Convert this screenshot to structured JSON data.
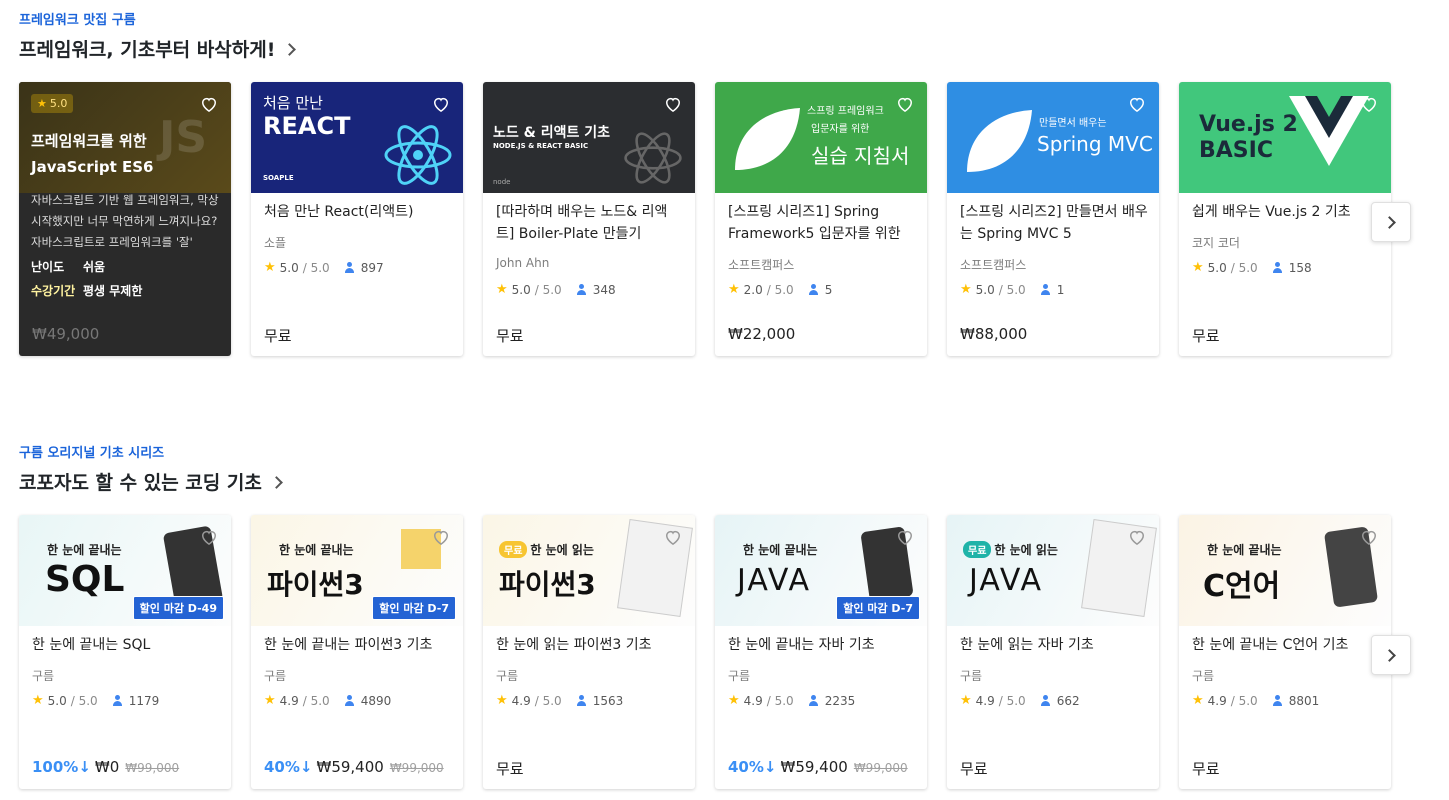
{
  "sections": [
    {
      "eyebrow": "프레임워크 맛집 구름",
      "heading": "프레임워크, 기초부터 바삭하게!",
      "cards": [
        {
          "hover": true,
          "badge_rating": "5.0",
          "title_line1": "프레임워크를 위한",
          "title_line2": "JavaScript ES6",
          "thumb_text": "JS",
          "description": "자바스크립트 기반 웹 프레임워크, 막상 시작했지만 너무 막연하게 느껴지나요? 자바스크립트로 프레임워크를 '잘'",
          "difficulty_label": "난이도",
          "difficulty_value": "쉬움",
          "period_label": "수강기간",
          "period_value": "평생 무제한",
          "price": "₩49,000"
        },
        {
          "title": "처음 만난 React(리액트)",
          "instructor": "소플",
          "rating": "5.0",
          "max": "/ 5.0",
          "students": "897",
          "price": "무료",
          "thumb_line1": "처음 만난",
          "thumb_line2": "REACT",
          "thumb_brand": "SOAPLE"
        },
        {
          "title": "[따라하며 배우는 노드& 리액트] Boiler-Plate 만들기",
          "instructor": "John Ahn",
          "rating": "5.0",
          "max": "/ 5.0",
          "students": "348",
          "price": "무료",
          "thumb_line1": "노드 & 리액트 기초",
          "thumb_line2": "NODE.JS & REACT BASIC",
          "thumb_brand": "node"
        },
        {
          "title": "[스프링 시리즈1] Spring Framework5 입문자를 위한",
          "instructor": "소프트캠퍼스",
          "rating": "2.0",
          "max": "/ 5.0",
          "students": "5",
          "price": "₩22,000",
          "thumb_line1": "스프링 프레임워크",
          "thumb_line2": "입문자를 위한",
          "thumb_line3": "실습 지침서"
        },
        {
          "title": "[스프링 시리즈2] 만들면서 배우는 Spring MVC 5",
          "instructor": "소프트캠퍼스",
          "rating": "5.0",
          "max": "/ 5.0",
          "students": "1",
          "price": "₩88,000",
          "thumb_line1": "만들면서 배우는",
          "thumb_line2": "Spring MVC 5"
        },
        {
          "title": "쉽게 배우는 Vue.js 2 기초",
          "instructor": "코지 코더",
          "rating": "5.0",
          "max": "/ 5.0",
          "students": "158",
          "price": "무료",
          "thumb_line1": "Vue.js 2",
          "thumb_line2": "BASIC"
        }
      ]
    },
    {
      "eyebrow": "구름 오리지널 기초 시리즈",
      "heading": "코포자도 할 수 있는 코딩 기초",
      "cards": [
        {
          "title": "한 눈에 끝내는 SQL",
          "instructor": "구름",
          "rating": "5.0",
          "max": "/ 5.0",
          "students": "1179",
          "discount": "100%↓",
          "price": "₩0",
          "old_price": "₩99,000",
          "thumb_small": "한 눈에 끝내는",
          "thumb_big": "SQL",
          "tag": "할인 마감 D-49"
        },
        {
          "title": "한 눈에 끝내는 파이썬3 기초",
          "instructor": "구름",
          "rating": "4.9",
          "max": "/ 5.0",
          "students": "4890",
          "discount": "40%↓",
          "price": "₩59,400",
          "old_price": "₩99,000",
          "thumb_small": "한 눈에 끝내는",
          "thumb_big": "파이썬3",
          "tag": "할인 마감 D-7"
        },
        {
          "title": "한 눈에 읽는 파이썬3 기초",
          "instructor": "구름",
          "rating": "4.9",
          "max": "/ 5.0",
          "students": "1563",
          "price": "무료",
          "thumb_free": "무료",
          "thumb_small": "한 눈에 읽는",
          "thumb_big": "파이썬3"
        },
        {
          "title": "한 눈에 끝내는 자바 기초",
          "instructor": "구름",
          "rating": "4.9",
          "max": "/ 5.0",
          "students": "2235",
          "discount": "40%↓",
          "price": "₩59,400",
          "old_price": "₩99,000",
          "thumb_small": "한 눈에 끝내는",
          "thumb_big": "JAVA",
          "tag": "할인 마감 D-7"
        },
        {
          "title": "한 눈에 읽는 자바 기초",
          "instructor": "구름",
          "rating": "4.9",
          "max": "/ 5.0",
          "students": "662",
          "price": "무료",
          "thumb_free": "무료",
          "thumb_small": "한 눈에 읽는",
          "thumb_big": "JAVA"
        },
        {
          "title": "한 눈에 끝내는 C언어 기초",
          "instructor": "구름",
          "rating": "4.9",
          "max": "/ 5.0",
          "students": "8801",
          "price": "무료",
          "thumb_small": "한 눈에 끝내는",
          "thumb_big": "C언어"
        }
      ]
    }
  ],
  "icons": {
    "heart": "heart-outline-icon",
    "star": "star-icon",
    "students": "person-icon",
    "next": "chevron-right-icon"
  },
  "colors": {
    "accent": "#1b64da",
    "discount": "#3a8ff5",
    "star": "#ffc107",
    "tag": "#2463d4"
  }
}
